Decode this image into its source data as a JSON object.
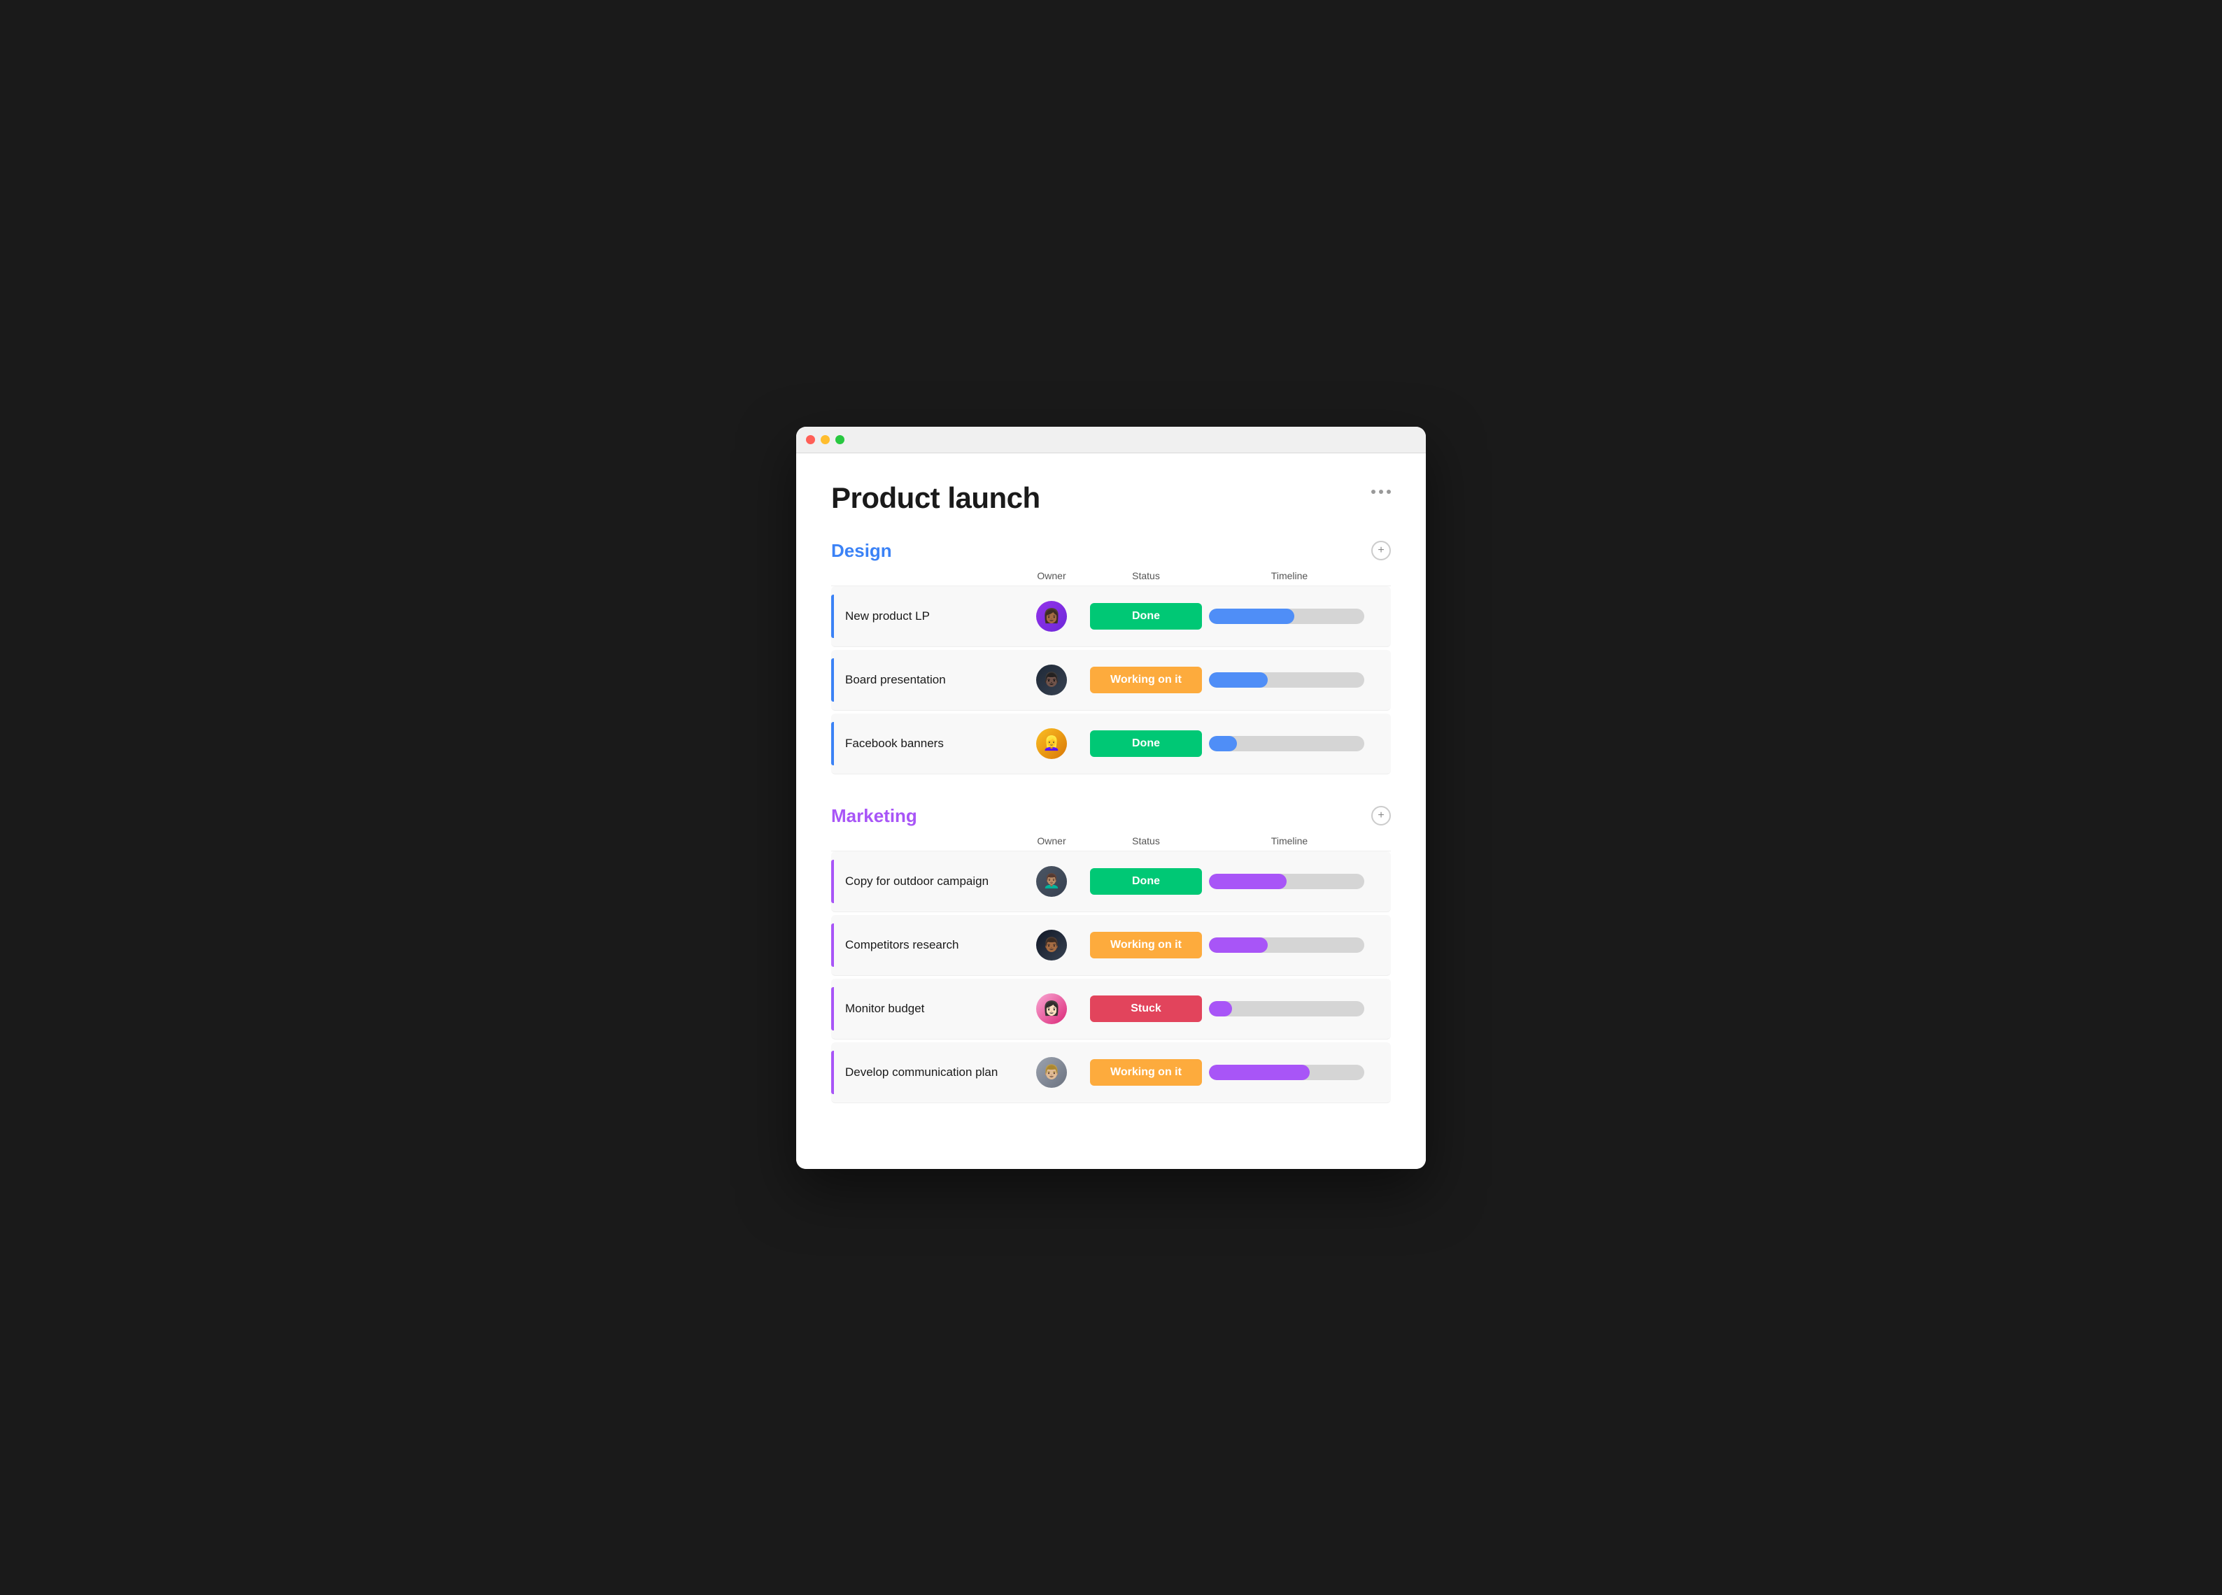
{
  "window": {
    "title": "Product launch"
  },
  "page": {
    "title": "Product launch",
    "more_options_label": "•••"
  },
  "design_section": {
    "title": "Design",
    "color": "design",
    "columns": {
      "owner": "Owner",
      "status": "Status",
      "timeline": "Timeline"
    },
    "add_label": "+",
    "tasks": [
      {
        "name": "New product LP",
        "status": "Done",
        "status_type": "done",
        "timeline_pct": 55,
        "timeline_color": "blue",
        "avatar_index": 1
      },
      {
        "name": "Board presentation",
        "status": "Working on it",
        "status_type": "working",
        "timeline_pct": 38,
        "timeline_color": "blue",
        "avatar_index": 2
      },
      {
        "name": "Facebook banners",
        "status": "Done",
        "status_type": "done",
        "timeline_pct": 18,
        "timeline_color": "blue",
        "avatar_index": 3
      }
    ]
  },
  "marketing_section": {
    "title": "Marketing",
    "color": "marketing",
    "columns": {
      "owner": "Owner",
      "status": "Status",
      "timeline": "Timeline"
    },
    "add_label": "+",
    "tasks": [
      {
        "name": "Copy for outdoor campaign",
        "status": "Done",
        "status_type": "done",
        "timeline_pct": 50,
        "timeline_color": "purple",
        "avatar_index": 4
      },
      {
        "name": "Competitors research",
        "status": "Working on it",
        "status_type": "working",
        "timeline_pct": 38,
        "timeline_color": "purple",
        "avatar_index": 5
      },
      {
        "name": "Monitor budget",
        "status": "Stuck",
        "status_type": "stuck",
        "timeline_pct": 15,
        "timeline_color": "purple",
        "avatar_index": 6
      },
      {
        "name": "Develop communication plan",
        "status": "Working on it",
        "status_type": "working",
        "timeline_pct": 65,
        "timeline_color": "purple",
        "avatar_index": 7
      }
    ]
  }
}
